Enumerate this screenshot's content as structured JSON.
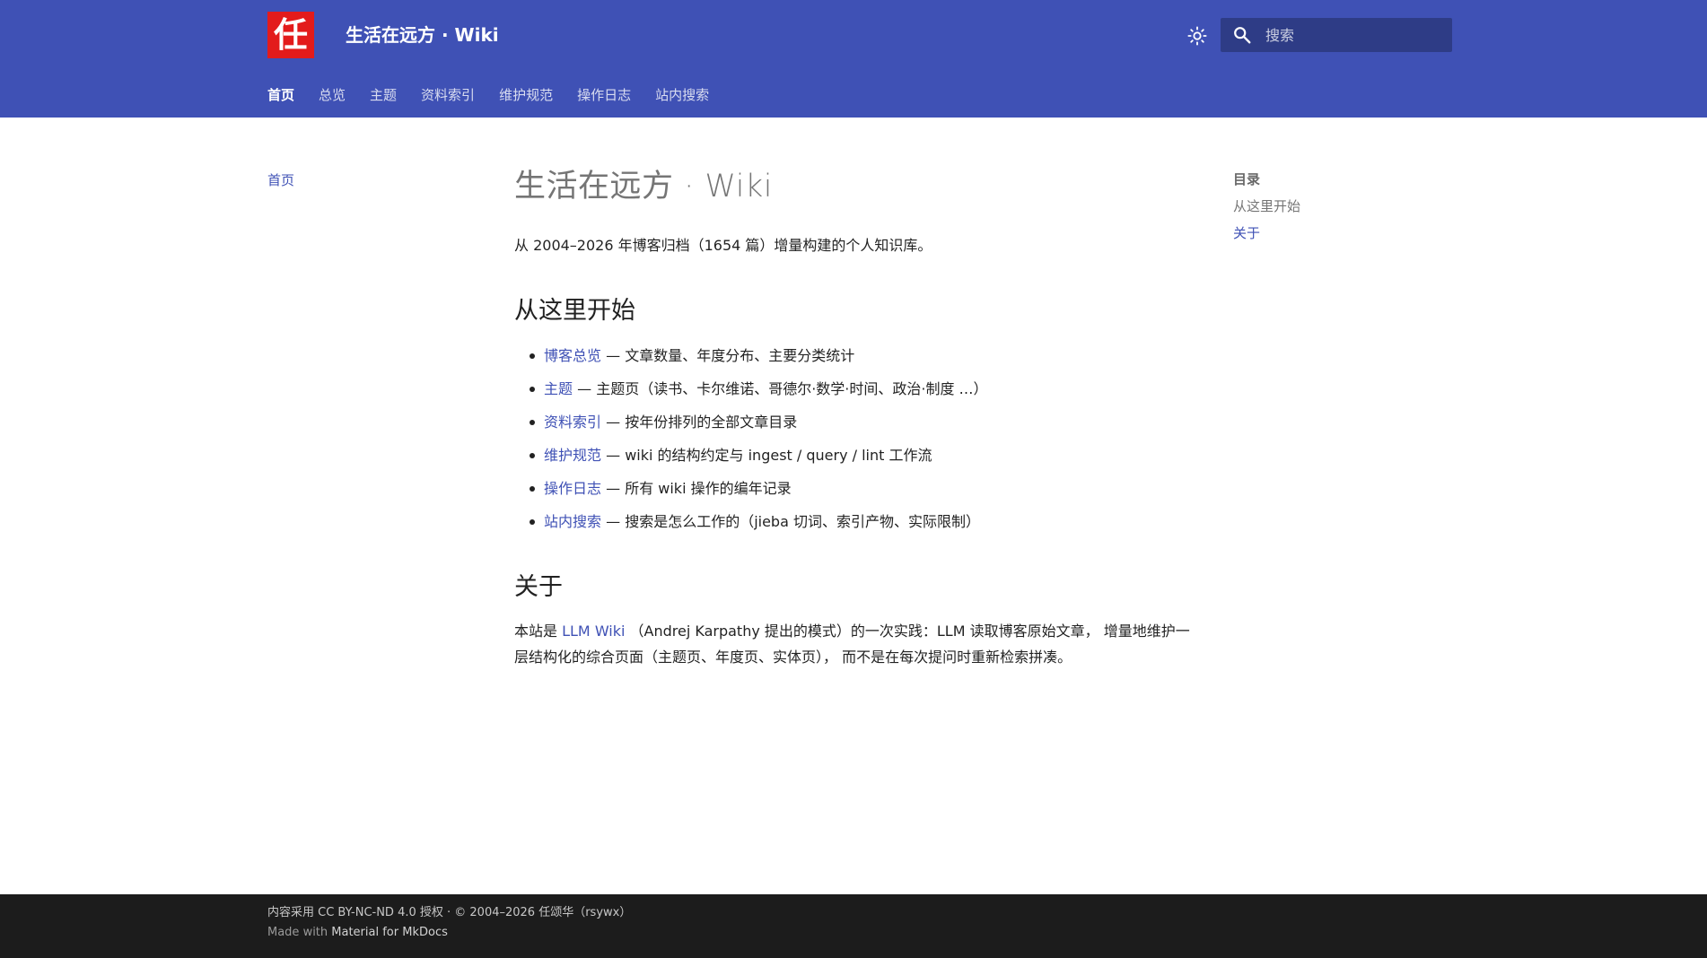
{
  "header": {
    "logo_char": "任",
    "site_title": "生活在远方 · Wiki",
    "search_placeholder": "搜索",
    "theme_toggle_icon": "brightness-icon",
    "colors": {
      "primary": "#3f51b5",
      "logo_bg": "#e31b1b"
    }
  },
  "tabs": [
    {
      "label": "首页",
      "active": true
    },
    {
      "label": "总览"
    },
    {
      "label": "主题"
    },
    {
      "label": "资料索引"
    },
    {
      "label": "维护规范"
    },
    {
      "label": "操作日志"
    },
    {
      "label": "站内搜索"
    }
  ],
  "left_nav": {
    "home": "首页"
  },
  "toc": {
    "title": "目录",
    "items": [
      {
        "label": "从这里开始"
      },
      {
        "label": "关于"
      }
    ]
  },
  "main": {
    "title": "生活在远方 · Wiki",
    "lead": "从 2004–2026 年博客归档（1654 篇）增量构建的个人知识库。",
    "start_heading": "从这里开始",
    "start_items": [
      {
        "link": "博客总览",
        "text": " — 文章数量、年度分布、主要分类统计"
      },
      {
        "link": "主题",
        "text": " — 主题页（读书、卡尔维诺、哥德尔·数学·时间、政治·制度 …）"
      },
      {
        "link": "资料索引",
        "text": " — 按年份排列的全部文章目录"
      },
      {
        "link": "维护规范",
        "text": " — wiki 的结构约定与 ingest / query / lint 工作流"
      },
      {
        "link": "操作日志",
        "text": " — 所有 wiki 操作的编年记录"
      },
      {
        "link": "站内搜索",
        "text": " — 搜索是怎么工作的（jieba 切词、索引产物、实际限制）"
      }
    ],
    "about_heading": "关于",
    "about_prefix": "本站是 ",
    "about_link": "LLM Wiki",
    "about_suffix": " （Andrej Karpathy 提出的模式）的一次实践：LLM 读取博客原始文章， 增量地维护一层结构化的综合页面（主题页、年度页、实体页）， 而不是在每次提问时重新检索拼凑。"
  },
  "footer": {
    "license": "内容采用 CC BY-NC-ND 4.0 授权 · © 2004–2026 任颂华（rsywx）",
    "made_with_prefix": "Made with ",
    "made_with_link": "Material for MkDocs"
  }
}
